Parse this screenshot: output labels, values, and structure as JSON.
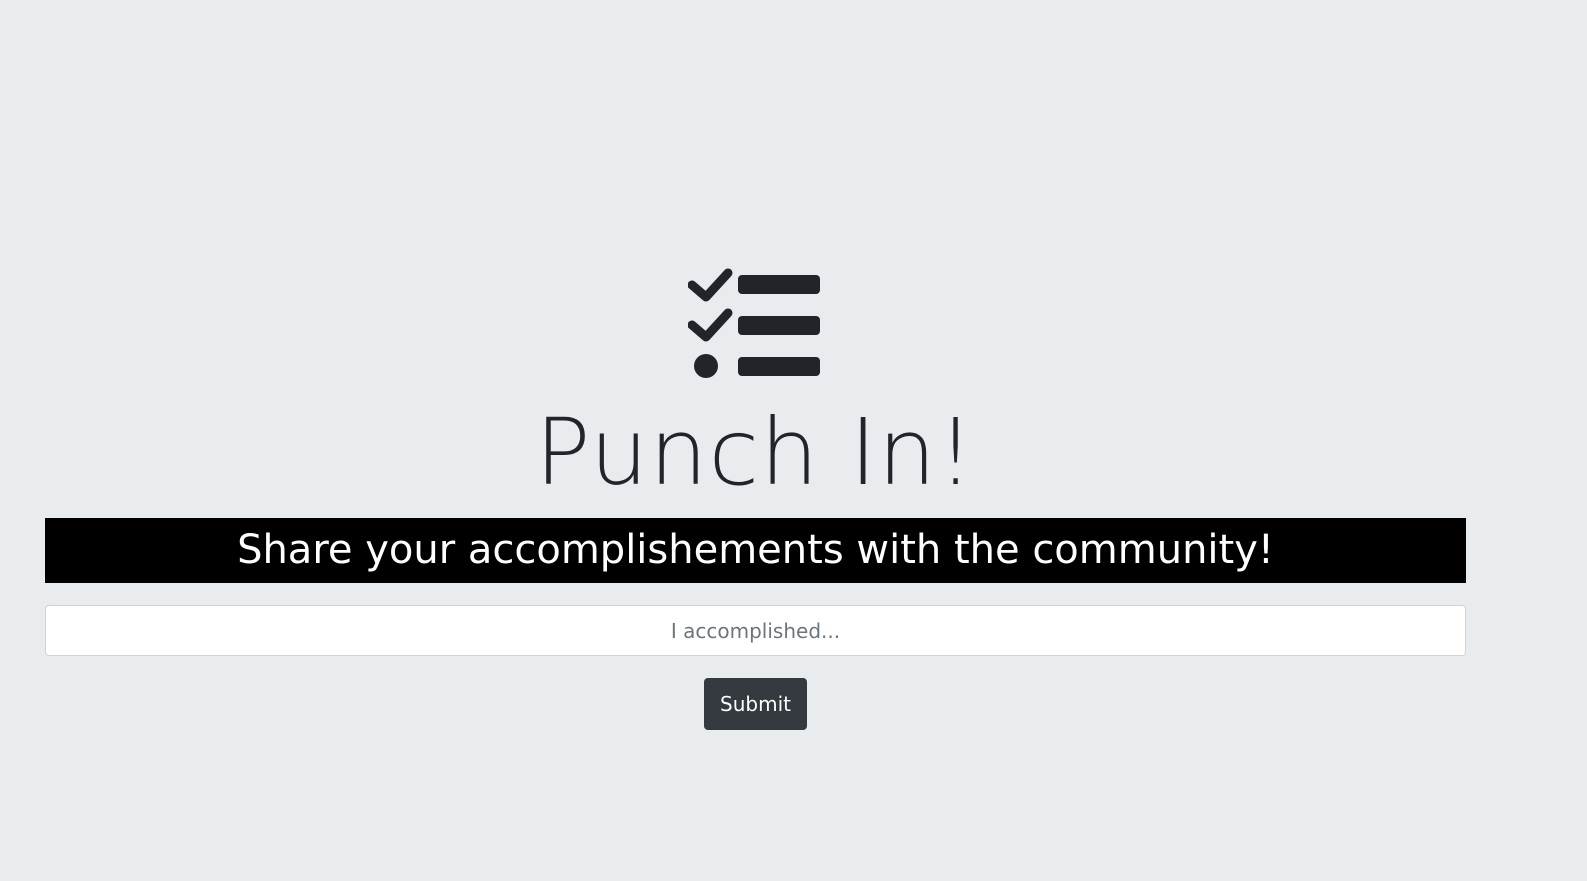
{
  "app": {
    "title": "Punch In!",
    "logo_icon": "tasks-checklist-icon"
  },
  "banner": {
    "text": "Share your accomplishements with the community!"
  },
  "form": {
    "input_value": "",
    "input_placeholder": "I accomplished...",
    "submit_label": "Submit"
  },
  "colors": {
    "background": "#e9ecef",
    "banner_background": "#000000",
    "banner_text": "#ffffff",
    "button_background": "#343a40",
    "text_dark": "#212529"
  }
}
